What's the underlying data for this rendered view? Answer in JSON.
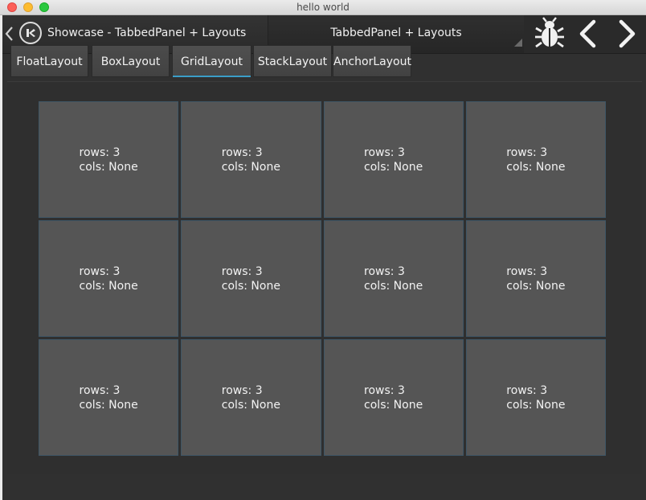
{
  "window": {
    "title": "hello world"
  },
  "actionbar": {
    "title": "Showcase - TabbedPanel + Layouts",
    "group_title": "TabbedPanel + Layouts",
    "icons": [
      "back-chevron-icon",
      "app-logo-icon",
      "bug-icon",
      "chevron-left-icon",
      "chevron-right-icon"
    ]
  },
  "tabs": [
    {
      "label": "FloatLayout",
      "active": false
    },
    {
      "label": "BoxLayout",
      "active": false
    },
    {
      "label": "GridLayout",
      "active": true
    },
    {
      "label": "StackLayout",
      "active": false
    },
    {
      "label": "AnchorLayout",
      "active": false
    }
  ],
  "grid": {
    "rows": 3,
    "cols": 4,
    "cells": [
      {
        "line1": "rows: 3",
        "line2": "cols: None"
      },
      {
        "line1": "rows: 3",
        "line2": "cols: None"
      },
      {
        "line1": "rows: 3",
        "line2": "cols: None"
      },
      {
        "line1": "rows: 3",
        "line2": "cols: None"
      },
      {
        "line1": "rows: 3",
        "line2": "cols: None"
      },
      {
        "line1": "rows: 3",
        "line2": "cols: None"
      },
      {
        "line1": "rows: 3",
        "line2": "cols: None"
      },
      {
        "line1": "rows: 3",
        "line2": "cols: None"
      },
      {
        "line1": "rows: 3",
        "line2": "cols: None"
      },
      {
        "line1": "rows: 3",
        "line2": "cols: None"
      },
      {
        "line1": "rows: 3",
        "line2": "cols: None"
      },
      {
        "line1": "rows: 3",
        "line2": "cols: None"
      }
    ]
  },
  "colors": {
    "accent": "#3a9ec8",
    "cell_bg": "#555555",
    "background": "#303030"
  }
}
